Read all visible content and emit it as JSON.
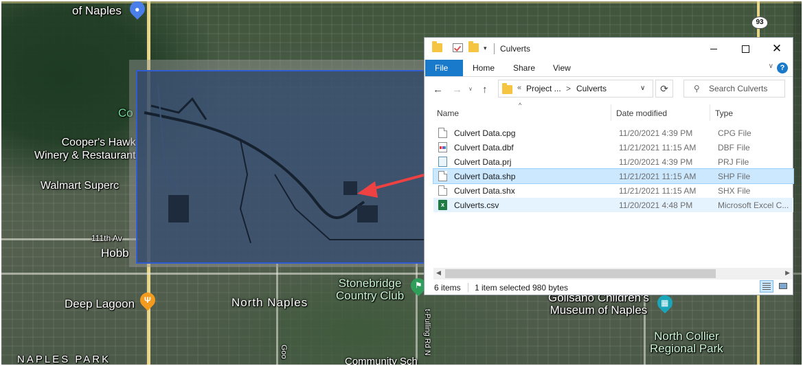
{
  "map": {
    "labels": {
      "of_naples": "of Naples",
      "co": "Co",
      "coopers_hawk": "Cooper's Hawk\nWinery & Restaurant",
      "walmart": "Walmart Superc",
      "street_111": "111th Av",
      "hobb": "Hobb",
      "deep_lagoon": "Deep Lagoon",
      "north_naples": "North Naples",
      "naples_park": "NAPLES PARK",
      "stonebridge": "Stonebridge\nCountry Club",
      "pulling": "t-Pulling Rd N",
      "goo": "Goo",
      "community": "Community Sch",
      "golisano": "Golisano Children's\nMuseum of Naples",
      "north_collier": "North Collier\nRegional Park",
      "route_93": "93"
    },
    "colors": {
      "selection_fill": "#30486c",
      "selection_border": "#2f5bd3",
      "arrow": "#ee4242"
    }
  },
  "explorer": {
    "title": "Culverts",
    "qa_dropdown": "▾",
    "ribbon": {
      "file": "File",
      "home": "Home",
      "share": "Share",
      "view": "View",
      "expand": "∨",
      "help": "?"
    },
    "nav": {
      "back": "←",
      "forward": "→",
      "recent": "∨",
      "up": "↑",
      "refresh": "⟳"
    },
    "address": {
      "chevron": "«",
      "project": "Project ...",
      "separator": ">",
      "current": "Culverts",
      "dropdown": "∨"
    },
    "search": {
      "placeholder": "Search Culverts",
      "icon": "⚲"
    },
    "columns": {
      "sort": "^",
      "name": "Name",
      "date": "Date modified",
      "type": "Type"
    },
    "files": [
      {
        "name": "Culvert Data.cpg",
        "date": "11/20/2021 4:39 PM",
        "type": "CPG File",
        "icon": "document-icon"
      },
      {
        "name": "Culvert Data.dbf",
        "date": "11/21/2021 11:15 AM",
        "type": "DBF File",
        "icon": "dbf-icon"
      },
      {
        "name": "Culvert Data.prj",
        "date": "11/20/2021 4:39 PM",
        "type": "PRJ File",
        "icon": "prj-icon"
      },
      {
        "name": "Culvert Data.shp",
        "date": "11/21/2021 11:15 AM",
        "type": "SHP File",
        "icon": "document-icon"
      },
      {
        "name": "Culvert Data.shx",
        "date": "11/21/2021 11:15 AM",
        "type": "SHX File",
        "icon": "document-icon"
      },
      {
        "name": "Culverts.csv",
        "date": "11/20/2021 4:48 PM",
        "type": "Microsoft Excel C...",
        "icon": "excel-icon"
      }
    ],
    "excel_letter": "x",
    "status": {
      "count": "6 items",
      "selected": "1 item selected",
      "size": "980 bytes"
    },
    "scroll": {
      "left": "◀",
      "right": "▶"
    }
  }
}
